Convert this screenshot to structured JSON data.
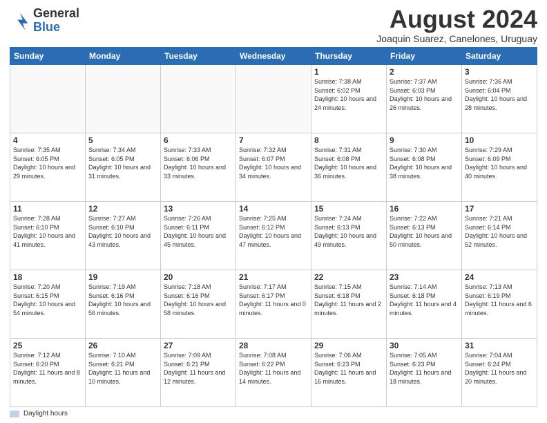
{
  "header": {
    "logo_general": "General",
    "logo_blue": "Blue",
    "title": "August 2024",
    "location": "Joaquin Suarez, Canelones, Uruguay"
  },
  "days_of_week": [
    "Sunday",
    "Monday",
    "Tuesday",
    "Wednesday",
    "Thursday",
    "Friday",
    "Saturday"
  ],
  "legend_label": "Daylight hours",
  "weeks": [
    [
      {
        "day": "",
        "info": ""
      },
      {
        "day": "",
        "info": ""
      },
      {
        "day": "",
        "info": ""
      },
      {
        "day": "",
        "info": ""
      },
      {
        "day": "1",
        "info": "Sunrise: 7:38 AM\nSunset: 6:02 PM\nDaylight: 10 hours and 24 minutes."
      },
      {
        "day": "2",
        "info": "Sunrise: 7:37 AM\nSunset: 6:03 PM\nDaylight: 10 hours and 26 minutes."
      },
      {
        "day": "3",
        "info": "Sunrise: 7:36 AM\nSunset: 6:04 PM\nDaylight: 10 hours and 28 minutes."
      }
    ],
    [
      {
        "day": "4",
        "info": "Sunrise: 7:35 AM\nSunset: 6:05 PM\nDaylight: 10 hours and 29 minutes."
      },
      {
        "day": "5",
        "info": "Sunrise: 7:34 AM\nSunset: 6:05 PM\nDaylight: 10 hours and 31 minutes."
      },
      {
        "day": "6",
        "info": "Sunrise: 7:33 AM\nSunset: 6:06 PM\nDaylight: 10 hours and 33 minutes."
      },
      {
        "day": "7",
        "info": "Sunrise: 7:32 AM\nSunset: 6:07 PM\nDaylight: 10 hours and 34 minutes."
      },
      {
        "day": "8",
        "info": "Sunrise: 7:31 AM\nSunset: 6:08 PM\nDaylight: 10 hours and 36 minutes."
      },
      {
        "day": "9",
        "info": "Sunrise: 7:30 AM\nSunset: 6:08 PM\nDaylight: 10 hours and 38 minutes."
      },
      {
        "day": "10",
        "info": "Sunrise: 7:29 AM\nSunset: 6:09 PM\nDaylight: 10 hours and 40 minutes."
      }
    ],
    [
      {
        "day": "11",
        "info": "Sunrise: 7:28 AM\nSunset: 6:10 PM\nDaylight: 10 hours and 41 minutes."
      },
      {
        "day": "12",
        "info": "Sunrise: 7:27 AM\nSunset: 6:10 PM\nDaylight: 10 hours and 43 minutes."
      },
      {
        "day": "13",
        "info": "Sunrise: 7:26 AM\nSunset: 6:11 PM\nDaylight: 10 hours and 45 minutes."
      },
      {
        "day": "14",
        "info": "Sunrise: 7:25 AM\nSunset: 6:12 PM\nDaylight: 10 hours and 47 minutes."
      },
      {
        "day": "15",
        "info": "Sunrise: 7:24 AM\nSunset: 6:13 PM\nDaylight: 10 hours and 49 minutes."
      },
      {
        "day": "16",
        "info": "Sunrise: 7:22 AM\nSunset: 6:13 PM\nDaylight: 10 hours and 50 minutes."
      },
      {
        "day": "17",
        "info": "Sunrise: 7:21 AM\nSunset: 6:14 PM\nDaylight: 10 hours and 52 minutes."
      }
    ],
    [
      {
        "day": "18",
        "info": "Sunrise: 7:20 AM\nSunset: 6:15 PM\nDaylight: 10 hours and 54 minutes."
      },
      {
        "day": "19",
        "info": "Sunrise: 7:19 AM\nSunset: 6:16 PM\nDaylight: 10 hours and 56 minutes."
      },
      {
        "day": "20",
        "info": "Sunrise: 7:18 AM\nSunset: 6:16 PM\nDaylight: 10 hours and 58 minutes."
      },
      {
        "day": "21",
        "info": "Sunrise: 7:17 AM\nSunset: 6:17 PM\nDaylight: 11 hours and 0 minutes."
      },
      {
        "day": "22",
        "info": "Sunrise: 7:15 AM\nSunset: 6:18 PM\nDaylight: 11 hours and 2 minutes."
      },
      {
        "day": "23",
        "info": "Sunrise: 7:14 AM\nSunset: 6:18 PM\nDaylight: 11 hours and 4 minutes."
      },
      {
        "day": "24",
        "info": "Sunrise: 7:13 AM\nSunset: 6:19 PM\nDaylight: 11 hours and 6 minutes."
      }
    ],
    [
      {
        "day": "25",
        "info": "Sunrise: 7:12 AM\nSunset: 6:20 PM\nDaylight: 11 hours and 8 minutes."
      },
      {
        "day": "26",
        "info": "Sunrise: 7:10 AM\nSunset: 6:21 PM\nDaylight: 11 hours and 10 minutes."
      },
      {
        "day": "27",
        "info": "Sunrise: 7:09 AM\nSunset: 6:21 PM\nDaylight: 11 hours and 12 minutes."
      },
      {
        "day": "28",
        "info": "Sunrise: 7:08 AM\nSunset: 6:22 PM\nDaylight: 11 hours and 14 minutes."
      },
      {
        "day": "29",
        "info": "Sunrise: 7:06 AM\nSunset: 6:23 PM\nDaylight: 11 hours and 16 minutes."
      },
      {
        "day": "30",
        "info": "Sunrise: 7:05 AM\nSunset: 6:23 PM\nDaylight: 11 hours and 18 minutes."
      },
      {
        "day": "31",
        "info": "Sunrise: 7:04 AM\nSunset: 6:24 PM\nDaylight: 11 hours and 20 minutes."
      }
    ]
  ]
}
